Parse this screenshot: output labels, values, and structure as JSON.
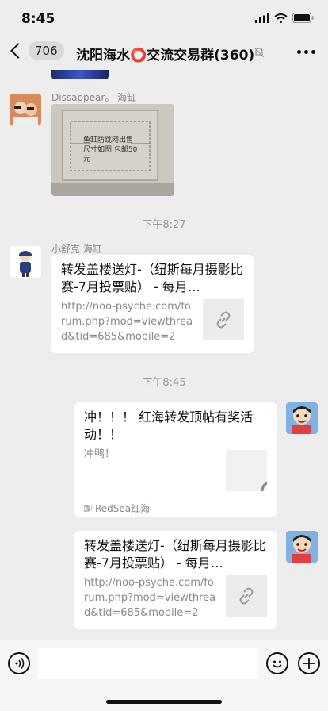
{
  "status_bar": {
    "time": "8:45"
  },
  "nav": {
    "unread_count": "706",
    "title": "沈阳海水⭕交流交易群(360)"
  },
  "messages": {
    "msg1": {
      "sender": "Dissappear。 海缸",
      "image_text": "鱼缸防跳网出售\n尺寸如图 包邮50\n元"
    },
    "time1": "下午8:27",
    "msg2": {
      "sender": "小舒克 海缸",
      "title": "转发盖楼送灯-（纽斯每月摄影比赛-7月投票贴） - 每月…",
      "url": "http://noo-psyche.com/forum.php?mod=viewthread&tid=685&mobile=2"
    },
    "time2": "下午8:45",
    "msg3": {
      "title": "冲！！！ 红海转发顶帖有奖活动！！",
      "desc": "冲鸭！",
      "source": "RedSea红海"
    },
    "msg4": {
      "title": "转发盖楼送灯-（纽斯每月摄影比赛-7月投票贴） - 每月…",
      "url": "http://noo-psyche.com/forum.php?mod=viewthread&tid=685&mobile=2"
    }
  },
  "icons": {
    "back": "chevron-left-icon",
    "mute": "bell-slash-icon",
    "more": "ellipsis-icon",
    "voice": "voice-icon",
    "emoji": "smiley-icon",
    "add": "plus-icon",
    "link": "link-icon"
  }
}
